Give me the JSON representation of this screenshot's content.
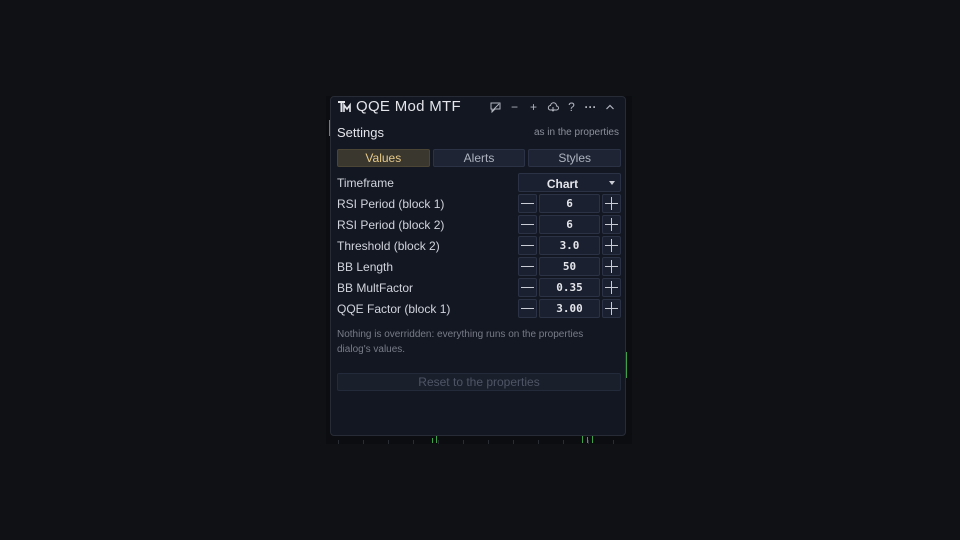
{
  "panel": {
    "title": "QQE Mod MTF",
    "logo_icon": "tm-logo-icon",
    "toolbar_icons": [
      "comment-icon",
      "minus-icon",
      "plus-icon",
      "cloud-icon",
      "help-icon",
      "more-icon",
      "collapse-icon"
    ],
    "toolbar_labels": {
      "minus": "−",
      "plus": "+",
      "help": "?",
      "more": "···"
    }
  },
  "settings": {
    "title": "Settings",
    "note": "as in the properties"
  },
  "tabs": [
    {
      "label": "Values",
      "active": true
    },
    {
      "label": "Alerts",
      "active": false
    },
    {
      "label": "Styles",
      "active": false
    }
  ],
  "fields": {
    "timeframe": {
      "label": "Timeframe",
      "value": "Chart"
    },
    "rsi1": {
      "label": "RSI Period (block 1)",
      "value": "6"
    },
    "rsi2": {
      "label": "RSI Period (block 2)",
      "value": "6"
    },
    "threshold": {
      "label": "Threshold (block 2)",
      "value": "3.0"
    },
    "bb_length": {
      "label": "BB Length",
      "value": "50"
    },
    "bb_mult": {
      "label": "BB MultFactor",
      "value": "0.35"
    },
    "qqe": {
      "label": "QQE Factor (block 1)",
      "value": "3.00"
    }
  },
  "info_text": "Nothing is overridden: everything runs on the properties dialog's values.",
  "reset_label": "Reset to the properties",
  "colors": {
    "background": "#0f1115",
    "panel": "#131722",
    "active_tab_text": "#e6c989",
    "candle_green": "#3fa14a"
  }
}
